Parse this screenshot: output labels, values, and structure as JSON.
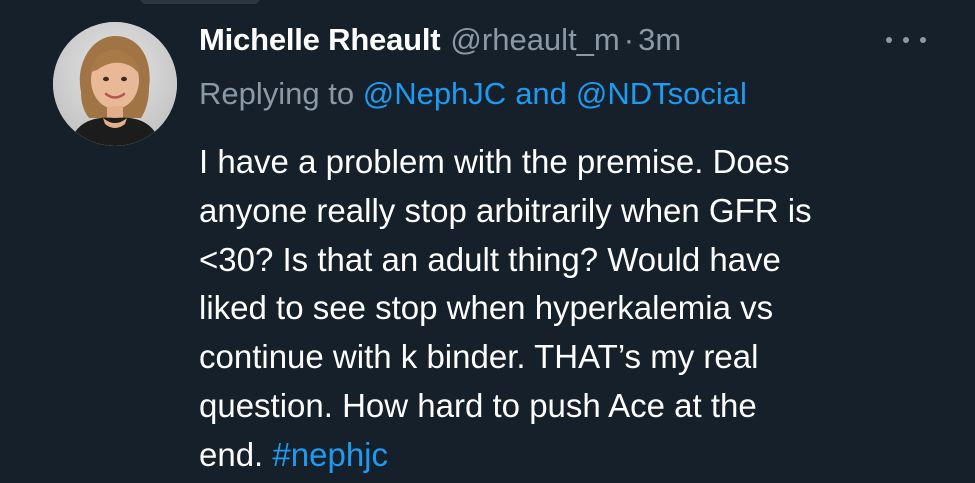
{
  "tweet": {
    "author": {
      "display_name": "Michelle Rheault",
      "handle": "@rheault_m",
      "avatar_icon": "avatar-photo"
    },
    "separator": "·",
    "timestamp": "3m",
    "more_icon": "more-dots-icon",
    "reply_to": {
      "prefix": "Replying to",
      "mentions": [
        "@NephJC",
        "@NDTsocial"
      ],
      "conjunction": "and"
    },
    "text_lines": [
      "I have a problem with the premise. Does",
      "anyone really stop arbitrarily when GFR is",
      "<30? Is that an adult thing? Would have",
      "liked to see stop when hyperkalemia vs",
      "continue with k binder. THAT’s my real",
      "question.  How hard to push Ace at the",
      "end."
    ],
    "hashtag": "#nephjc"
  },
  "colors": {
    "background": "#15202b",
    "primary_text": "#ffffff",
    "secondary_text": "#8b98a5",
    "link": "#1d9bf0"
  }
}
